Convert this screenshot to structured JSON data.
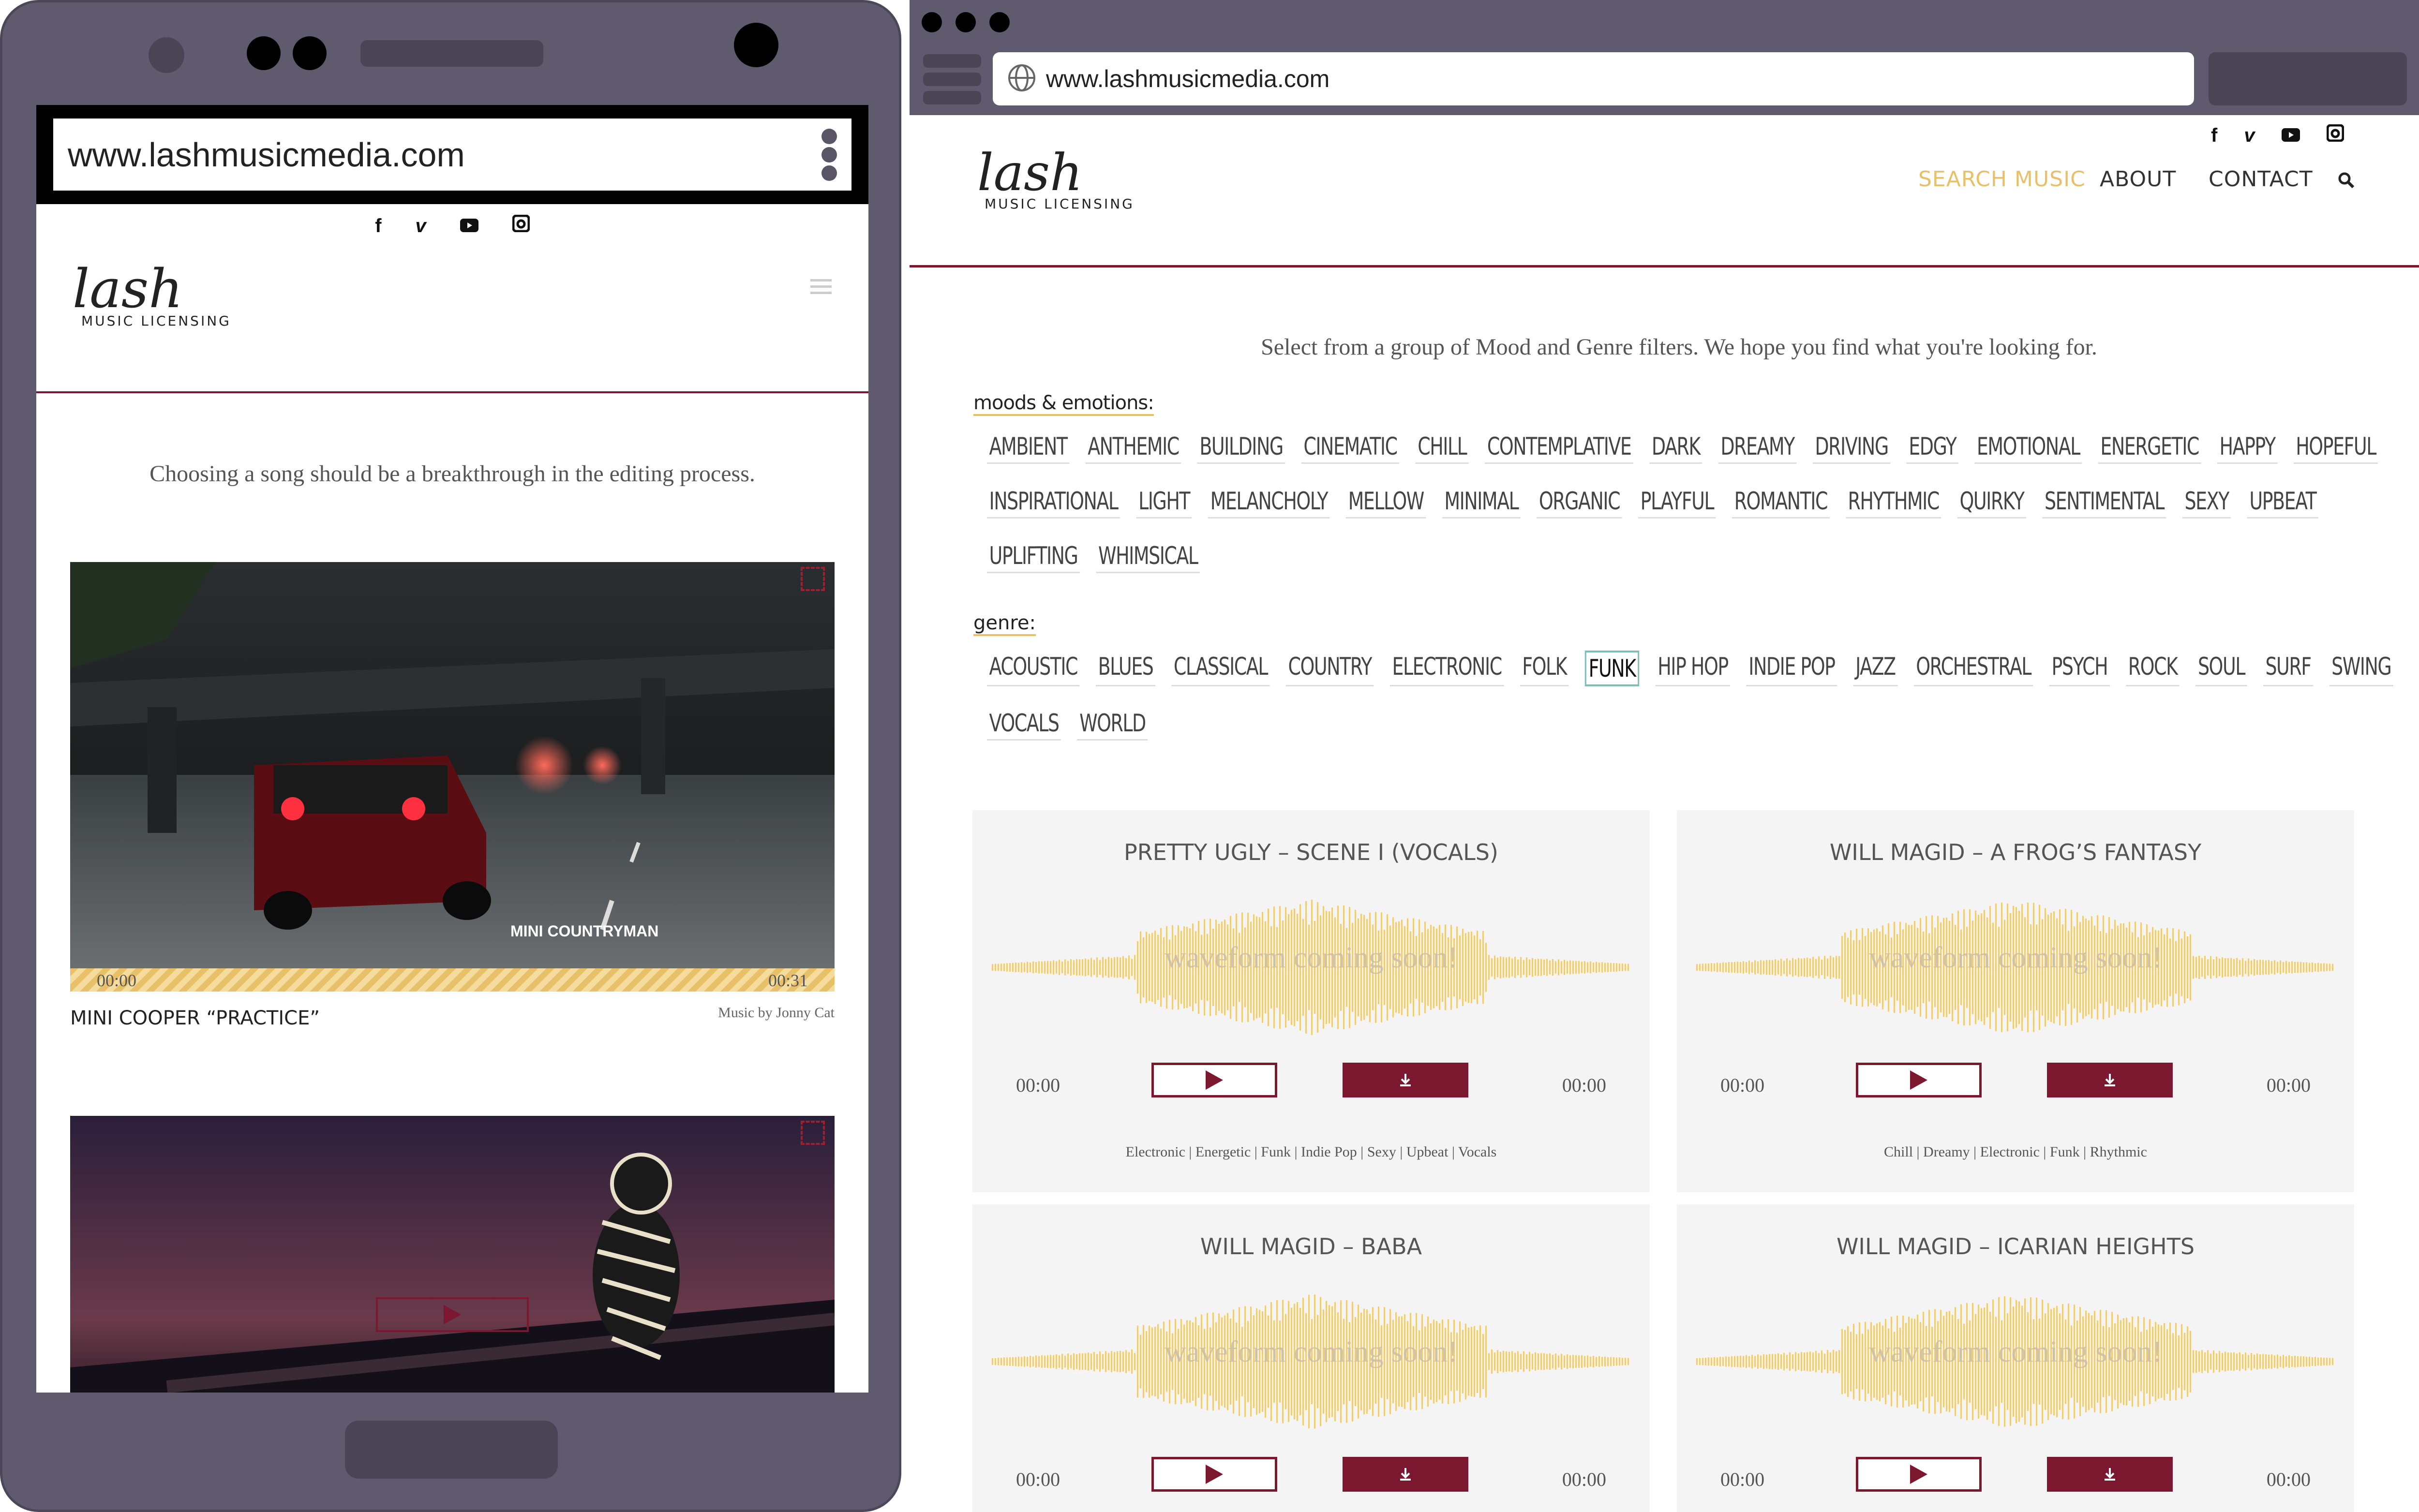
{
  "phone": {
    "url": "www.lashmusicmedia.com",
    "logo_script": "lash",
    "logo_sub": "MUSIC LICENSING",
    "tagline": "Choosing a song should be a breakthrough in the editing process.",
    "video1": {
      "overlay": "MINI COUNTRYMAN",
      "time_start": "00:00",
      "time_end": "00:31",
      "title": "MINI COOPER “PRACTICE”",
      "credit": "Music by Jonny Cat"
    }
  },
  "browser": {
    "url": "www.lashmusicmedia.com",
    "logo_script": "lash",
    "logo_sub": "MUSIC LICENSING",
    "nav": {
      "search_music": "SEARCH MUSIC",
      "about": "ABOUT",
      "contact": "CONTACT"
    },
    "accent_color": "#e8c06a",
    "brand_color": "#7b1830",
    "intro": "Select from a group of Mood and Genre filters. We hope you find what you're looking for.",
    "moods_label": "moods & emotions:",
    "moods_rows": [
      [
        "AMBIENT",
        "ANTHEMIC",
        "BUILDING",
        "CINEMATIC",
        "CHILL",
        "CONTEMPLATIVE",
        "DARK",
        "DREAMY",
        "DRIVING",
        "EDGY",
        "EMOTIONAL",
        "ENERGETIC",
        "HAPPY",
        "HOPEFUL"
      ],
      [
        "INSPIRATIONAL",
        "LIGHT",
        "MELANCHOLY",
        "MELLOW",
        "MINIMAL",
        "ORGANIC",
        "PLAYFUL",
        "ROMANTIC",
        "RHYTHMIC",
        "QUIRKY",
        "SENTIMENTAL",
        "SEXY",
        "UPBEAT"
      ],
      [
        "UPLIFTING",
        "WHIMSICAL"
      ]
    ],
    "genre_label": "genre:",
    "genre_rows": [
      [
        "ACOUSTIC",
        "BLUES",
        "CLASSICAL",
        "COUNTRY",
        "ELECTRONIC",
        "FOLK",
        "FUNK",
        "HIP HOP",
        "INDIE POP",
        "JAZZ",
        "ORCHESTRAL",
        "PSYCH",
        "ROCK",
        "SOUL",
        "SURF",
        "SWING"
      ],
      [
        "VOCALS",
        "WORLD"
      ]
    ],
    "selected_genre": "FUNK",
    "tracks": [
      {
        "title": "PRETTY UGLY – SCENE I (VOCALS)",
        "waveform": "waveform coming soon!",
        "time_left": "00:00",
        "time_right": "00:00",
        "tags": "Electronic | Energetic | Funk | Indie Pop | Sexy | Upbeat | Vocals"
      },
      {
        "title": "WILL MAGID – A FROG’S FANTASY",
        "waveform": "waveform coming soon!",
        "time_left": "00:00",
        "time_right": "00:00",
        "tags": "Chill | Dreamy | Electronic | Funk | Rhythmic"
      },
      {
        "title": "WILL MAGID – BABA",
        "waveform": "waveform coming soon!",
        "time_left": "00:00",
        "time_right": "00:00",
        "tags": ""
      },
      {
        "title": "WILL MAGID – ICARIAN HEIGHTS",
        "waveform": "waveform coming soon!",
        "time_left": "00:00",
        "time_right": "00:00",
        "tags": ""
      }
    ]
  }
}
